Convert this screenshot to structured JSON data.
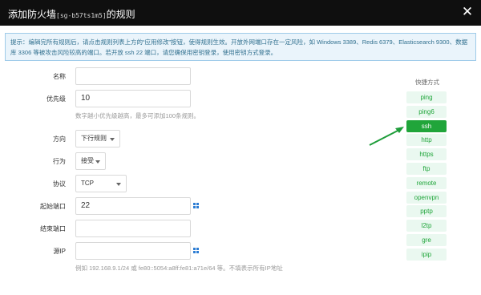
{
  "dialog": {
    "title_prefix": "添加防火墙",
    "title_id": "[sg-b57ts1m5]",
    "title_suffix": "的规则"
  },
  "notice": {
    "text": "提示：编辑完所有规则后，请点击规则列表上方的“应用修改”按钮，使得规则生效。开放外网端口存在一定风险，如 Windows 3389、Redis 6379、Elasticsearch 9300、数据库 3306 等被攻击风险较高的端口。若开放 ssh 22 端口，请您确保用密钥登录，使用密钥方式登录。"
  },
  "form": {
    "name_label": "名称",
    "name_value": "",
    "priority_label": "优先级",
    "priority_value": "10",
    "priority_hint": "数字越小优先级越高，最多可添加100条规则。",
    "direction_label": "方向",
    "direction_value": "下行规则",
    "action_label": "行为",
    "action_value": "接受",
    "protocol_label": "协议",
    "protocol_value": "TCP",
    "start_port_label": "起始端口",
    "start_port_value": "22",
    "end_port_label": "结束端口",
    "end_port_value": "",
    "source_ip_label": "源IP",
    "source_ip_value": "",
    "source_ip_hint": "例如 192.168.9.1/24 或 fe80::5054:a8ff:fe81:a71e/64 等。不填表示所有IP地址"
  },
  "quick": {
    "title": "快捷方式",
    "items": [
      "ping",
      "ping6",
      "ssh",
      "http",
      "https",
      "ftp",
      "remote",
      "openvpn",
      "pptp",
      "l2tp",
      "gre",
      "ipip"
    ],
    "active": "ssh"
  },
  "colors": {
    "header": "#0f0f0f",
    "accent": "#20a53a",
    "link": "#2b7cd3"
  }
}
